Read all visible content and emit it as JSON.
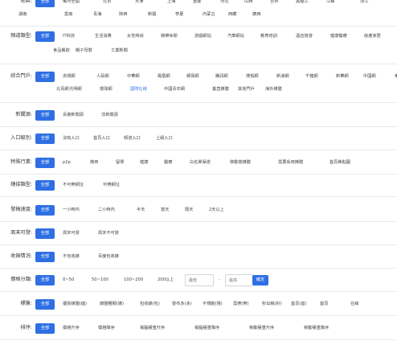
{
  "filters": {
    "all_label": "全部",
    "region": {
      "label": "地區:",
      "line1": [
        "每月全國",
        "北京",
        "天津",
        "上海",
        "重慶",
        "河北",
        "山西",
        "吉林",
        "黑龍江",
        "江蘇",
        "浙江"
      ],
      "line2": [
        "湖南",
        "雲南",
        "青海",
        "陝西",
        "新疆",
        "寧夏",
        "內蒙古",
        "西藏",
        "廣西"
      ]
    },
    "channel": {
      "label": "頻道類型:",
      "line1": [
        "IT科技",
        "生活消費",
        "女性時尚",
        "娛樂休閒",
        "游戲網站",
        "汽車網站",
        "教育培訓",
        "酒店旅游",
        "健康醫療",
        "房產家居"
      ],
      "line2": [
        "食品餐飲",
        "親子母嬰",
        "工業新聞"
      ]
    },
    "portal": {
      "label": "綜合門戶:",
      "line1": [
        "央視網",
        "人民網",
        "中華網",
        "鳳凰網",
        "網易網",
        "騰訊網",
        "搜狐網",
        "新浪網",
        "千龍網",
        "新華網",
        "中國網",
        "東方網"
      ],
      "line2": [
        "北青網",
        "光明網",
        "環球網",
        "國際在線",
        "中國青年網",
        "垂直媒體",
        "其他門戶",
        "海外媒體"
      ]
    },
    "news_source": {
      "label": "新聞源:",
      "opts": [
        "百度新聞源",
        "非新聞源"
      ]
    },
    "entry": {
      "label": "入口級別:",
      "opts": [
        "沒有入口",
        "首頁入口",
        "頻道入口",
        "上級入口"
      ]
    },
    "industry": {
      "label": "特殊行業:",
      "opts": [
        "p2p",
        "微商",
        "留學",
        "健康",
        "醫療",
        "白名單渠道",
        "移動端媒體",
        "需要采用媒體",
        "首頁焦點圖"
      ]
    },
    "link": {
      "label": "鏈接類型:",
      "opts": [
        "不可帶網址",
        "可帶網址"
      ]
    },
    "speed": {
      "label": "發稿速度:",
      "opts": [
        "一小時內",
        "二小時內",
        "半天",
        "當天",
        "隔天",
        "2天以上"
      ]
    },
    "weekend": {
      "label": "周末可發:",
      "opts": [
        "周末可發",
        "周末不可發"
      ]
    },
    "include": {
      "label": "收錄情況:",
      "opts": [
        "不包收錄",
        "百度包收錄"
      ]
    },
    "price": {
      "label": "價格分類:",
      "opts": [
        "0~50",
        "50~100",
        "100~200",
        "200以上"
      ],
      "min_placeholder": "最低",
      "dash": "-",
      "max_placeholder": "最高",
      "confirm": "確定"
    },
    "tags": {
      "label": "標簽:",
      "opts": [
        "優質媒體(鏈)",
        "媒體種類(媒)",
        "包收錄(包)",
        "發布多(多)",
        "不規範(慢)",
        "需帶(帶)",
        "秒出稿(秒)",
        "首頁(首)",
        "首頁",
        "在線"
      ]
    },
    "sort": {
      "label": "排序:",
      "opts": [
        "價格升序",
        "價格降序",
        "電腦權重升序",
        "電腦權重降序",
        "移動權重升序",
        "移動權重降序"
      ]
    }
  }
}
